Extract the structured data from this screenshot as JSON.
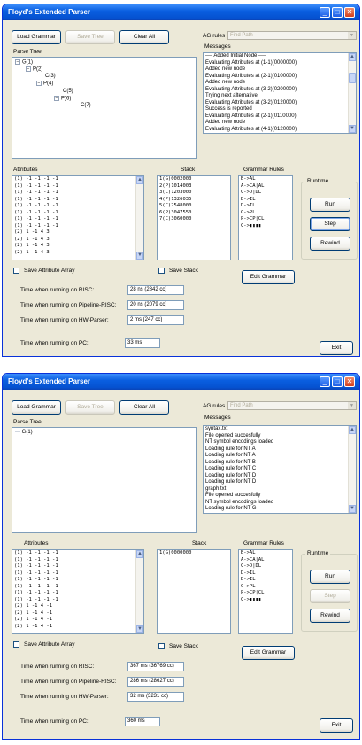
{
  "window1": {
    "title": "Floyd's Extended Parser",
    "buttons": {
      "load_grammar": "Load Grammar",
      "save_tree": "Save Tree",
      "clear_all": "Clear All",
      "edit_grammar": "Edit Grammar",
      "run": "Run",
      "step": "Step",
      "rewind": "Rewind",
      "exit": "Exit"
    },
    "ag_rules_label": "AG rules",
    "ag_rules_value": "Find Path",
    "parse_tree_label": "Parse Tree",
    "messages_label": "Messages",
    "tree_nodes": [
      "G(1)",
      "P(2)",
      "C(3)",
      "P(4)",
      "C(5)",
      "P(6)",
      "C(7)"
    ],
    "messages": [
      "---- Added Initial Node ----",
      "Evaluating Attributes at (1-1)(0000000)",
      "Added new node",
      "Evaluating Attributes at (2-1)(0100000)",
      "Added new node",
      "Evaluating Attributes at (3-2)(0200000)",
      "Trying next alternative",
      "Evaluating Attributes at (3-2)(0120000)",
      "Success is reported",
      "Evaluating Attributes at (2-1)(0110000)",
      "Added new node",
      "Evaluating Attributes at (4-1)(0120000)"
    ],
    "attributes_label": "Attributes",
    "attributes": [
      "(1) -1 -1 -1 -1",
      "(1) -1 -1 -1 -1",
      "(1) -1 -1 -1 -1",
      "(1) -1 -1 -1 -1",
      "(1) -1 -1 -1 -1",
      "(1) -1 -1 -1 -1",
      "(1) -1 -1 -1 -1",
      "(1) -1 -1 -1 -1",
      "(2) 1 -1 4 3",
      "(2) 1 -1 4 3",
      "(2) 1 -1 4 3",
      "(2) 1 -1 4 3"
    ],
    "stack_label": "Stack",
    "stack": [
      "1(G)0002000",
      "2(P)1014003",
      "3(C)1203000",
      "4(P)1326035",
      "5(C)2548000",
      "6(P)3047550",
      "7(C)3060000"
    ],
    "grammar_rules_label": "Grammar Rules",
    "grammar_rules": [
      "B->AL",
      "A->CA|AL",
      "C->D|DL",
      "D->IL",
      "D->IL",
      "G->PL",
      "P->CP|CL",
      "C->▮▮▮▮"
    ],
    "runtime_label": "Runtime",
    "save_attribute_array": "Save Attribute Array",
    "save_stack": "Save Stack",
    "time_labels": {
      "risc": "Time when running on RISC:",
      "pipeline": "Time when running on Pipeline-RISC:",
      "hw": "Time when running on HW-Parser:",
      "pc": "Time when running on PC:"
    },
    "times": {
      "risc": "28 ns (2842 cc)",
      "pipeline": "20 ns (2079 cc)",
      "hw": "2 ms (247 cc)",
      "pc": "33 ms"
    }
  },
  "window2": {
    "title": "Floyd's Extended Parser",
    "buttons": {
      "load_grammar": "Load Grammar",
      "save_tree": "Save Tree",
      "clear_all": "Clear All",
      "edit_grammar": "Edit Grammar",
      "run": "Run",
      "step": "Step",
      "rewind": "Rewind",
      "exit": "Exit"
    },
    "ag_rules_label": "AG rules",
    "ag_rules_value": "Find Path",
    "parse_tree_label": "Parse Tree",
    "messages_label": "Messages",
    "tree_nodes": [
      "G(1)"
    ],
    "messages": [
      "syntax.txt",
      "File opened succesfully",
      "NT symbol encodings loaded",
      "Loading rule for NT A",
      "Loading rule for NT A",
      "Loading rule for NT B",
      "Loading rule for NT C",
      "Loading rule for NT D",
      "Loading rule for NT D",
      "graph.txt",
      "File opened succesfully",
      "NT symbol encodings loaded",
      "Loading rule for NT G"
    ],
    "attributes_label": "Attributes",
    "attributes": [
      "(1) -1 -1 -1 -1",
      "(1) -1 -1 -1 -1",
      "(1) -1 -1 -1 -1",
      "(1) -1 -1 -1 -1",
      "(1) -1 -1 -1 -1",
      "(1) -1 -1 -1 -1",
      "(1) -1 -1 -1 -1",
      "(1) -1 -1 -1 -1",
      "(2) 1 -1 4 -1",
      "(2) 1 -1 4 -1",
      "(2) 1 -1 4 -1",
      "(2) 1 -1 4 -1"
    ],
    "stack_label": "Stack",
    "stack": [
      "1(G)0000000"
    ],
    "grammar_rules_label": "Grammar Rules",
    "grammar_rules": [
      "B->AL",
      "A->CA|AL",
      "C->D|DL",
      "D->IL",
      "D->IL",
      "G->PL",
      "P->CP|CL",
      "C->▮▮▮▮"
    ],
    "runtime_label": "Runtime",
    "save_attribute_array": "Save Attribute Array",
    "save_stack": "Save Stack",
    "time_labels": {
      "risc": "Time when running on RISC:",
      "pipeline": "Time when running on Pipeline-RISC:",
      "hw": "Time when running on HW-Parser:",
      "pc": "Time when running on PC:"
    },
    "times": {
      "risc": "367 ms (36769 cc)",
      "pipeline": "286 ms (28627 cc)",
      "hw": "32 ms (3231 cc)",
      "pc": "360 ms"
    }
  }
}
